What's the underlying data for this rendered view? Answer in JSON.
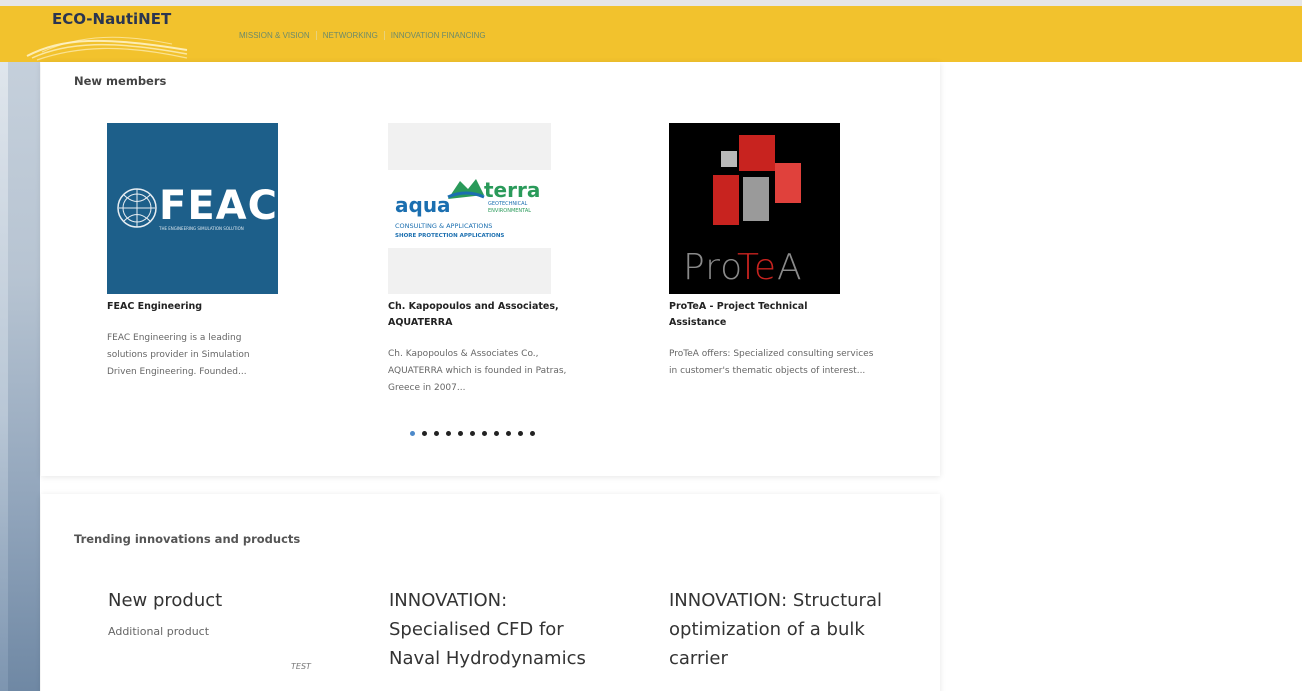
{
  "header": {
    "site_name": "ECO-NautiNET",
    "nav": [
      "MISSION & VISION",
      "NETWORKING",
      "INNOVATION FINANCING"
    ],
    "brand_color": "#f2c22d"
  },
  "members": {
    "title": "New members",
    "items": [
      {
        "name": "FEAC Engineering",
        "description": "FEAC Engineering is a leading solutions provider in Simulation Driven Engineering. Founded...",
        "logo_text": "FEAC",
        "logo_tagline": "THE ENGINEERING SIMULATION SOLUTION",
        "logo_bg": "#1d5f8a"
      },
      {
        "name": "Ch. Kapopoulos and Associates, AQUATERRA",
        "description": "Ch. Kapopoulos & Associates Co., AQUATERRA which is founded in Patras, Greece in 2007...",
        "logo_text_a": "aqua",
        "logo_text_b": "terra",
        "logo_line1": "GEOTECHNICAL",
        "logo_line2": "ENVIRONMENTAL",
        "logo_line3": "CONSULTING & APPLICATIONS",
        "logo_line4": "SHORE PROTECTION APPLICATIONS"
      },
      {
        "name": "ProTeA - Project Technical Assistance",
        "description": "ProTeA offers: Specialized consulting services in customer's thematic objects of interest...",
        "logo_text_a": "Pro",
        "logo_text_b": "Te",
        "logo_text_c": "A"
      }
    ],
    "carousel_pages": 11,
    "active_page": 1
  },
  "trending": {
    "title": "Trending innovations and products",
    "items": [
      {
        "title": "New product",
        "subtitle": "Additional product",
        "tag": "TEST"
      },
      {
        "title": "INNOVATION: Specialised CFD for Naval Hydrodynamics"
      },
      {
        "title": "INNOVATION: Structural optimization of a bulk carrier"
      }
    ]
  }
}
